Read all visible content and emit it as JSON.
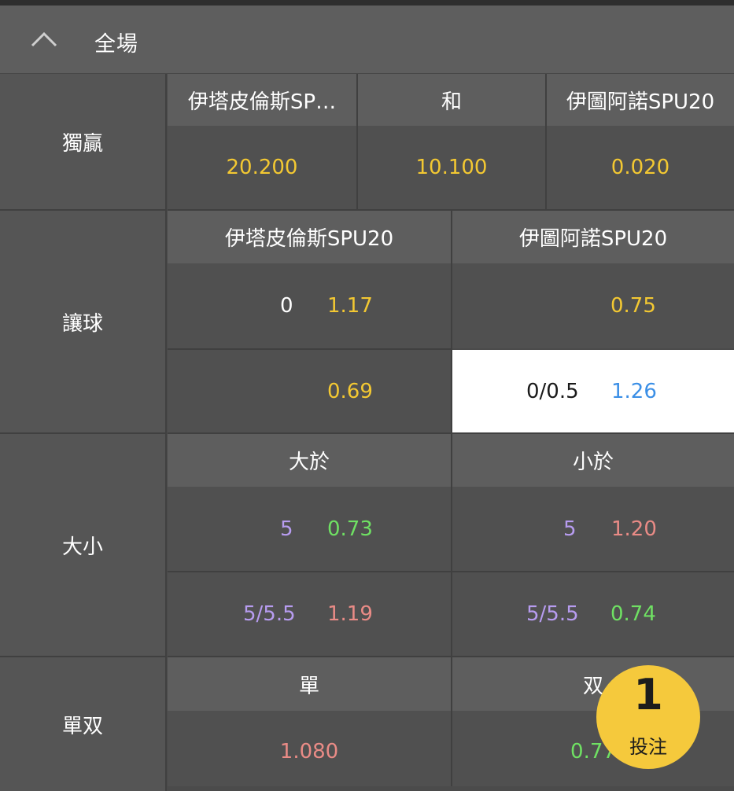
{
  "section": {
    "title": "全場"
  },
  "win": {
    "label": "獨贏",
    "headers": [
      "伊塔皮倫斯SP…",
      "和",
      "伊圖阿諾SPU20"
    ],
    "odds": [
      "20.200",
      "10.100",
      "0.020"
    ]
  },
  "handicap": {
    "label": "讓球",
    "headers": [
      "伊塔皮倫斯SPU20",
      "伊圖阿諾SPU20"
    ],
    "rows": [
      {
        "home_line": "0",
        "home_odds": "1.17",
        "away_line": "",
        "away_odds": "0.75"
      },
      {
        "home_line": "",
        "home_odds": "0.69",
        "away_line": "0/0.5",
        "away_odds": "1.26"
      }
    ]
  },
  "overunder": {
    "label": "大小",
    "headers": [
      "大於",
      "小於"
    ],
    "rows": [
      {
        "over_line": "5",
        "over_odds": "0.73",
        "under_line": "5",
        "under_odds": "1.20"
      },
      {
        "over_line": "5/5.5",
        "over_odds": "1.19",
        "under_line": "5/5.5",
        "under_odds": "0.74"
      }
    ]
  },
  "oddeven": {
    "label": "單双",
    "headers": [
      "單",
      "双"
    ],
    "odds": [
      "1.080",
      "0.77"
    ]
  },
  "bet_slip": {
    "count": "1",
    "label": "投注"
  },
  "colors": {
    "odds_yellow": "#f3c832",
    "odds_green": "#6fe063",
    "odds_red": "#e98b86",
    "odds_blue": "#3b8fe6",
    "line_purple": "#b79cf0",
    "bet_button": "#f5c93c"
  }
}
